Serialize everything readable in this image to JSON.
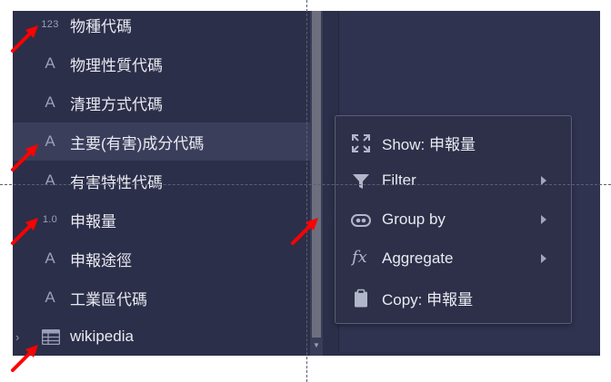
{
  "tree": {
    "rows": [
      {
        "icon": "numeric-icon",
        "icon_text": "123",
        "label": "物種代碼"
      },
      {
        "icon": "text-type-icon",
        "icon_text": "A",
        "label": "物理性質代碼"
      },
      {
        "icon": "text-type-icon",
        "icon_text": "A",
        "label": "清理方式代碼"
      },
      {
        "icon": "text-type-icon",
        "icon_text": "A",
        "label": "主要(有害)成分代碼",
        "selected": true
      },
      {
        "icon": "text-type-icon",
        "icon_text": "A",
        "label": "有害特性代碼"
      },
      {
        "icon": "decimal-icon",
        "icon_text": "1.0",
        "label": "申報量"
      },
      {
        "icon": "text-type-icon",
        "icon_text": "A",
        "label": "申報途徑"
      },
      {
        "icon": "text-type-icon",
        "icon_text": "A",
        "label": "工業區代碼"
      },
      {
        "icon": "table-icon",
        "icon_text": "",
        "label": "wikipedia",
        "expander": "›"
      }
    ]
  },
  "context_menu": {
    "items": [
      {
        "icon": "expand-icon",
        "label": "Show: 申報量",
        "has_submenu": false
      },
      {
        "icon": "filter-icon",
        "label": "Filter",
        "has_submenu": true
      },
      {
        "icon": "group-icon",
        "label": "Group by",
        "has_submenu": true
      },
      {
        "icon": "function-icon",
        "icon_text": "fx",
        "label": "Aggregate",
        "has_submenu": true
      },
      {
        "icon": "clipboard-icon",
        "label": "Copy: 申報量",
        "has_submenu": false
      }
    ]
  },
  "colors": {
    "panel_background": "#2c2f49",
    "selected_row": "#3b3e5a",
    "menu_background": "#2d3048",
    "menu_border": "#5a5e78",
    "text": "#e8e9f1",
    "icon": "#9aa0b8",
    "annotation_arrow": "#ff0000"
  }
}
